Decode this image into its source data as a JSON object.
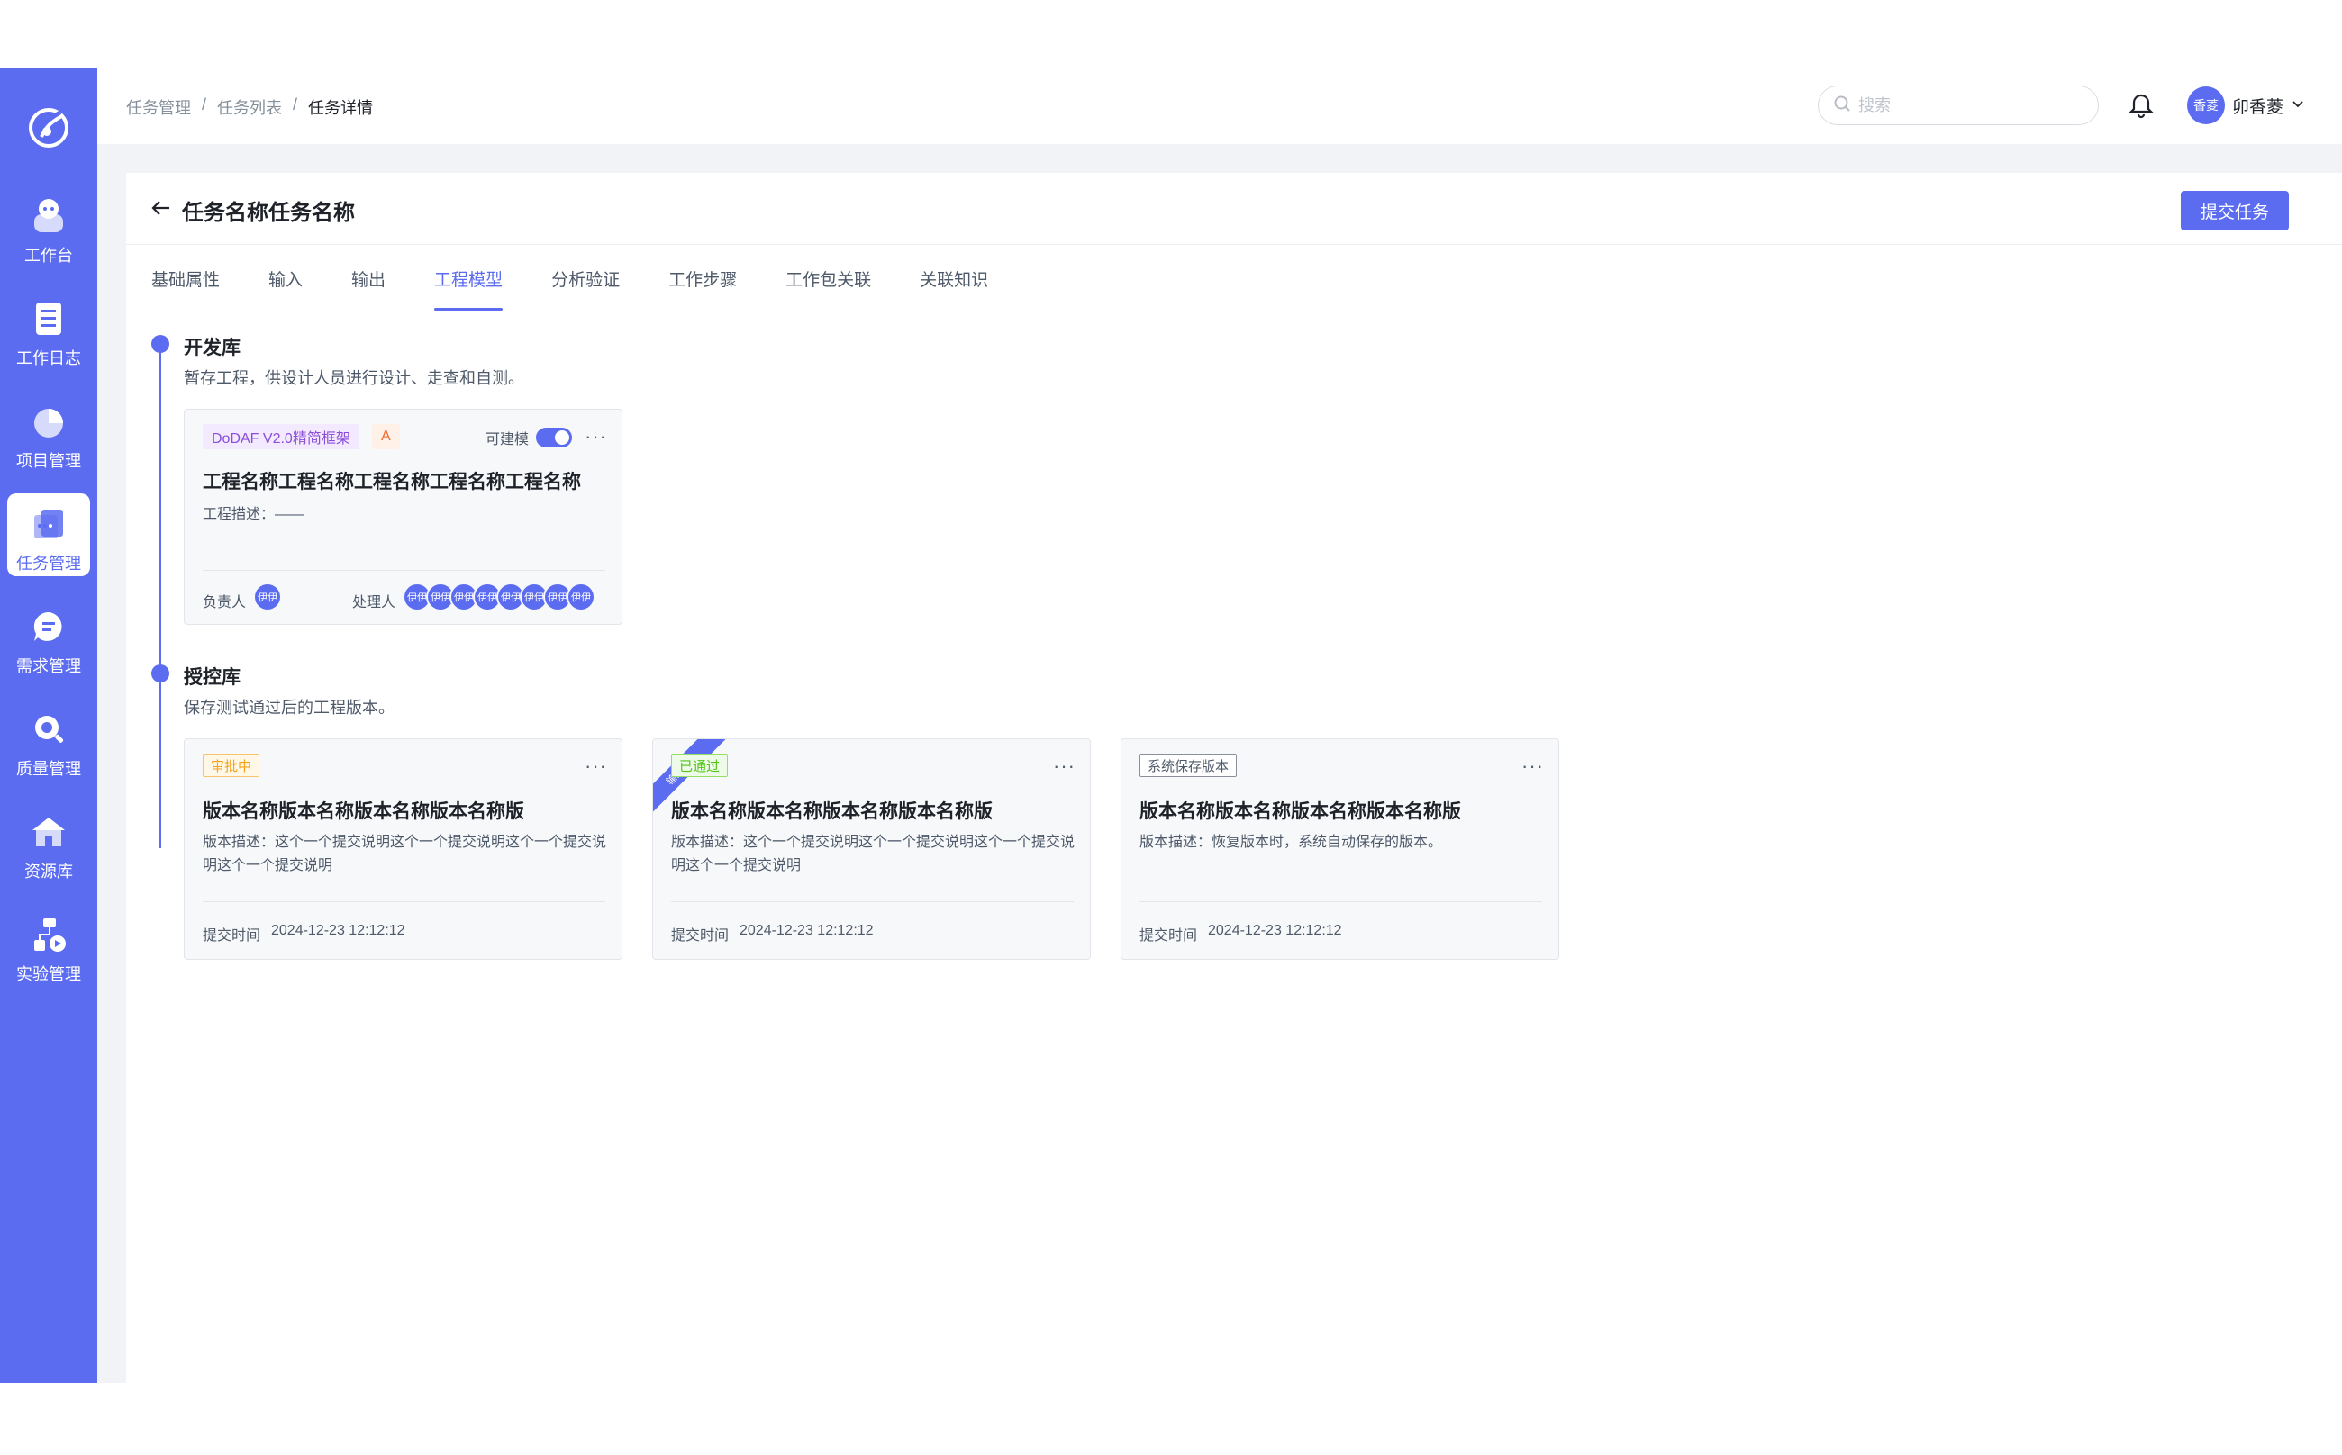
{
  "sidebar": {
    "items": [
      {
        "label": "工作台",
        "icon": "robot-icon"
      },
      {
        "label": "工作日志",
        "icon": "log-icon"
      },
      {
        "label": "项目管理",
        "icon": "pie-icon"
      },
      {
        "label": "任务管理",
        "icon": "task-icon"
      },
      {
        "label": "需求管理",
        "icon": "chat-icon"
      },
      {
        "label": "质量管理",
        "icon": "magnifier-icon"
      },
      {
        "label": "资源库",
        "icon": "house-icon"
      },
      {
        "label": "实验管理",
        "icon": "flow-icon"
      }
    ],
    "active_index": 3,
    "accent": "#5b6cf0"
  },
  "header": {
    "breadcrumb": [
      "任务管理",
      "任务列表",
      "任务详情"
    ],
    "breadcrumb_sep": "/",
    "search_placeholder": "搜索",
    "user": {
      "avatar_text": "香菱",
      "name": "卯香菱"
    }
  },
  "page": {
    "title": "任务名称任务名称",
    "submit_label": "提交任务",
    "tabs": [
      "基础属性",
      "输入",
      "输出",
      "工程模型",
      "分析验证",
      "工作步骤",
      "工作包关联",
      "关联知识"
    ],
    "active_tab": 3
  },
  "dev_lib": {
    "title": "开发库",
    "desc": "暂存工程，供设计人员进行设计、走查和自测。",
    "card": {
      "tag_framework": "DoDAF V2.0精简框架",
      "tag_level": "A",
      "switch_label": "可建模",
      "switch_on": true,
      "title": "工程名称工程名称工程名称工程名称工程名称",
      "desc": "工程描述：——",
      "owner_label": "负责人",
      "owner_avatar": "伊伊",
      "handler_label": "处理人",
      "handler_avatars": [
        "伊伊",
        "伊伊",
        "伊伊",
        "伊伊",
        "伊伊",
        "伊伊",
        "伊伊",
        "伊伊"
      ]
    }
  },
  "control_lib": {
    "title": "授控库",
    "desc": "保存测试通过后的工程版本。",
    "cards": [
      {
        "tag": "审批中",
        "title": "版本名称版本名称版本名称版本名称版",
        "desc": "版本描述：这个一个提交说明这个一个提交说明这个一个提交说明这个一个提交说明",
        "time_label": "提交时间",
        "time": "2024-12-23  12:12:12"
      },
      {
        "tag": "已通过",
        "ribbon": "输出版本",
        "title": "版本名称版本名称版本名称版本名称版",
        "desc": "版本描述：这个一个提交说明这个一个提交说明这个一个提交说明这个一个提交说明",
        "time_label": "提交时间",
        "time": "2024-12-23  12:12:12"
      },
      {
        "tag": "系统保存版本",
        "title": "版本名称版本名称版本名称版本名称版",
        "desc": "版本描述：恢复版本时，系统自动保存的版本。",
        "time_label": "提交时间",
        "time": "2024-12-23  12:12:12"
      }
    ]
  }
}
